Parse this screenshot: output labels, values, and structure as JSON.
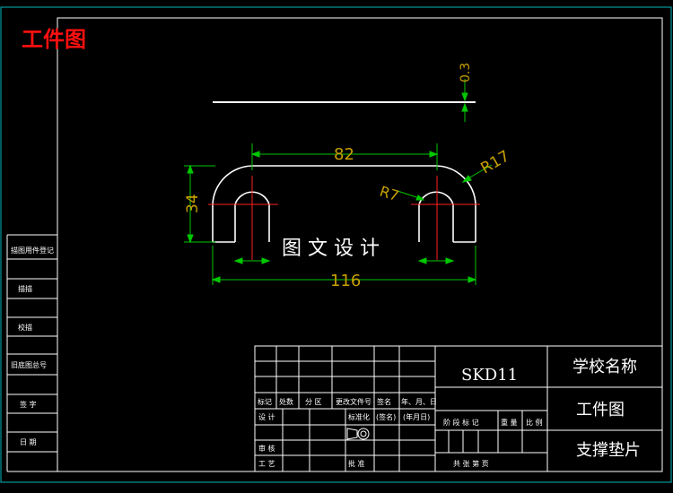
{
  "drawing": {
    "corner_title": "工件图",
    "watermark": "图 文 设 计",
    "dimensions": {
      "thickness": "0.3",
      "center_distance": "82",
      "overall_length": "116",
      "height": "34",
      "outer_radius": "R17",
      "inner_radius": "R7"
    }
  },
  "left_strip": {
    "labels": [
      "描图用件登记",
      "描描",
      "校描",
      "旧底图总号",
      "签 字",
      "日 期"
    ]
  },
  "title_block": {
    "material": "SKD11",
    "school_name": "学校名称",
    "drawing_type": "工件图",
    "part_name": "支撑垫片",
    "header_row": [
      "标记",
      "处数",
      "分 区",
      "更改文件号",
      "签名",
      "年、月、日"
    ],
    "row_design": [
      "设 计",
      "标准化",
      "(签名)",
      "(年月日)"
    ],
    "stage_headers": [
      "阶 段 标 记",
      "重 量",
      "比 例"
    ],
    "row_review": "审 核",
    "row_process": "工 艺",
    "approve": "批 准",
    "sheet_footer": "共 张 第 页"
  },
  "colors": {
    "frame": "#ffffff",
    "dimension": "#00c800",
    "centerline": "#ff2020",
    "title_red": "#ff1010",
    "background": "#000000"
  }
}
